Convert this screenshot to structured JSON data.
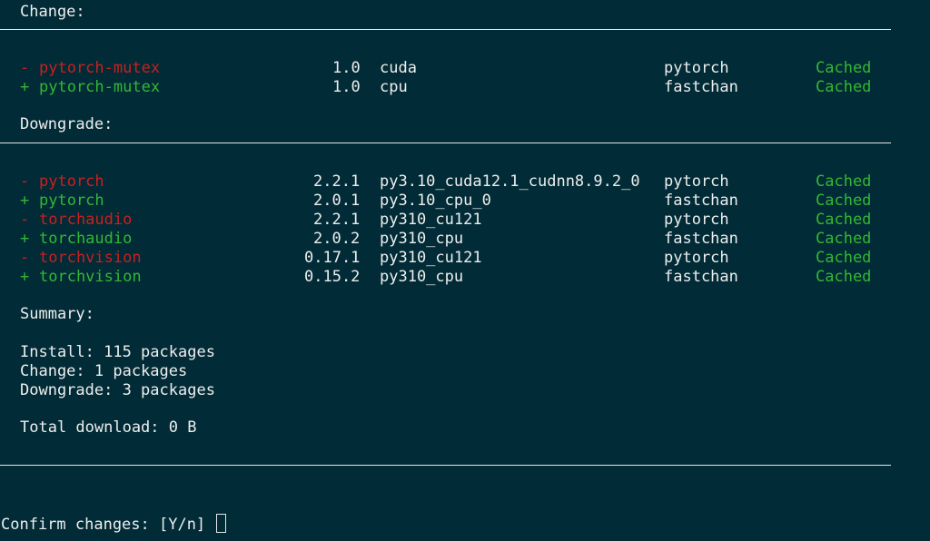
{
  "sections": {
    "change_header": "Change:",
    "downgrade_header": "Downgrade:",
    "summary_header": "Summary:"
  },
  "change_rows": [
    {
      "sign": "-",
      "name": "pytorch-mutex",
      "version": "1.0",
      "build": "cuda",
      "channel": "pytorch",
      "status": "Cached"
    },
    {
      "sign": "+",
      "name": "pytorch-mutex",
      "version": "1.0",
      "build": "cpu",
      "channel": "fastchan",
      "status": "Cached"
    }
  ],
  "downgrade_rows": [
    {
      "sign": "-",
      "name": "pytorch",
      "version": "2.2.1",
      "build": "py3.10_cuda12.1_cudnn8.9.2_0",
      "channel": "pytorch",
      "status": "Cached"
    },
    {
      "sign": "+",
      "name": "pytorch",
      "version": "2.0.1",
      "build": "py3.10_cpu_0",
      "channel": "fastchan",
      "status": "Cached"
    },
    {
      "sign": "-",
      "name": "torchaudio",
      "version": "2.2.1",
      "build": "py310_cu121",
      "channel": "pytorch",
      "status": "Cached"
    },
    {
      "sign": "+",
      "name": "torchaudio",
      "version": "2.0.2",
      "build": "py310_cpu",
      "channel": "fastchan",
      "status": "Cached"
    },
    {
      "sign": "-",
      "name": "torchvision",
      "version": "0.17.1",
      "build": "py310_cu121",
      "channel": "pytorch",
      "status": "Cached"
    },
    {
      "sign": "+",
      "name": "torchvision",
      "version": "0.15.2",
      "build": "py310_cpu",
      "channel": "fastchan",
      "status": "Cached"
    }
  ],
  "summary": {
    "install": "Install: 115 packages",
    "change": "Change: 1 packages",
    "downgrade": "Downgrade: 3 packages",
    "total_download": "Total download: 0 B"
  },
  "prompt": {
    "text": "Confirm changes: [Y/n]"
  },
  "colors": {
    "background": "#012b36",
    "text": "#eeeeee",
    "removed": "#cc1f1f",
    "added": "#33b833",
    "cached": "#33b833"
  }
}
